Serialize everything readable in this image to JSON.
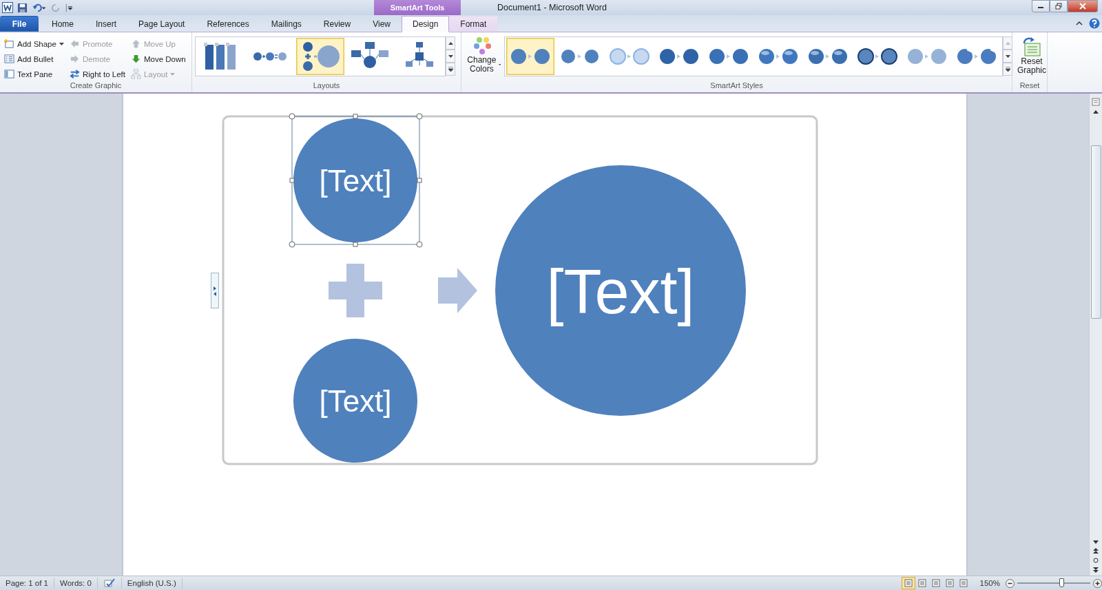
{
  "window": {
    "title": "Document1 - Microsoft Word"
  },
  "contextual_group": {
    "label": "SmartArt Tools"
  },
  "tabs": [
    {
      "label": "File",
      "kind": "file",
      "selected": false
    },
    {
      "label": "Home",
      "kind": "normal",
      "selected": false
    },
    {
      "label": "Insert",
      "kind": "normal",
      "selected": false
    },
    {
      "label": "Page Layout",
      "kind": "normal",
      "selected": false
    },
    {
      "label": "References",
      "kind": "normal",
      "selected": false
    },
    {
      "label": "Mailings",
      "kind": "normal",
      "selected": false
    },
    {
      "label": "Review",
      "kind": "normal",
      "selected": false
    },
    {
      "label": "View",
      "kind": "normal",
      "selected": false
    },
    {
      "label": "Design",
      "kind": "contextual",
      "selected": true
    },
    {
      "label": "Format",
      "kind": "contextual",
      "selected": false
    }
  ],
  "create_graphic": {
    "label": "Create Graphic",
    "columns": [
      [
        {
          "label": "Add Shape",
          "dropdown": true,
          "disabled": false
        },
        {
          "label": "Add Bullet",
          "dropdown": false,
          "disabled": false
        },
        {
          "label": "Text Pane",
          "dropdown": false,
          "disabled": false
        }
      ],
      [
        {
          "label": "Promote",
          "dropdown": false,
          "disabled": true
        },
        {
          "label": "Demote",
          "dropdown": false,
          "disabled": true
        },
        {
          "label": "Right to Left",
          "dropdown": false,
          "disabled": false
        }
      ],
      [
        {
          "label": "Move Up",
          "dropdown": false,
          "disabled": true
        },
        {
          "label": "Move Down",
          "dropdown": false,
          "disabled": false
        },
        {
          "label": "Layout",
          "dropdown": true,
          "disabled": true
        }
      ]
    ]
  },
  "layouts": {
    "label": "Layouts",
    "items": [
      {
        "kind": "bars",
        "selected": false
      },
      {
        "kind": "equation",
        "selected": false
      },
      {
        "kind": "plus-arrow",
        "selected": true
      },
      {
        "kind": "hub",
        "selected": false
      },
      {
        "kind": "radial",
        "selected": false
      }
    ]
  },
  "change_colors": {
    "label": "Change Colors"
  },
  "smartart_styles": {
    "label": "SmartArt Styles",
    "items": [
      {
        "kind": "flat",
        "selected": true
      },
      {
        "kind": "outline",
        "selected": false
      },
      {
        "kind": "light",
        "selected": false
      },
      {
        "kind": "dark",
        "selected": false
      },
      {
        "kind": "shadow",
        "selected": false
      },
      {
        "kind": "glossy",
        "selected": false
      },
      {
        "kind": "bevel",
        "selected": false
      },
      {
        "kind": "ring",
        "selected": false
      },
      {
        "kind": "faded",
        "selected": false
      },
      {
        "kind": "cylinder",
        "selected": false
      }
    ]
  },
  "reset": {
    "label": "Reset",
    "button": "Reset Graphic"
  },
  "diagram": {
    "inputs": [
      "[Text]",
      "[Text]"
    ],
    "result": "[Text]"
  },
  "status_bar": {
    "page": "Page: 1 of 1",
    "words": "Words: 0",
    "language": "English (U.S.)",
    "views": [
      {
        "selected": true
      },
      {
        "selected": false
      },
      {
        "selected": false
      },
      {
        "selected": false
      },
      {
        "selected": false
      }
    ],
    "zoom": "150%",
    "zoom_level": {
      "level": 0.6
    }
  }
}
